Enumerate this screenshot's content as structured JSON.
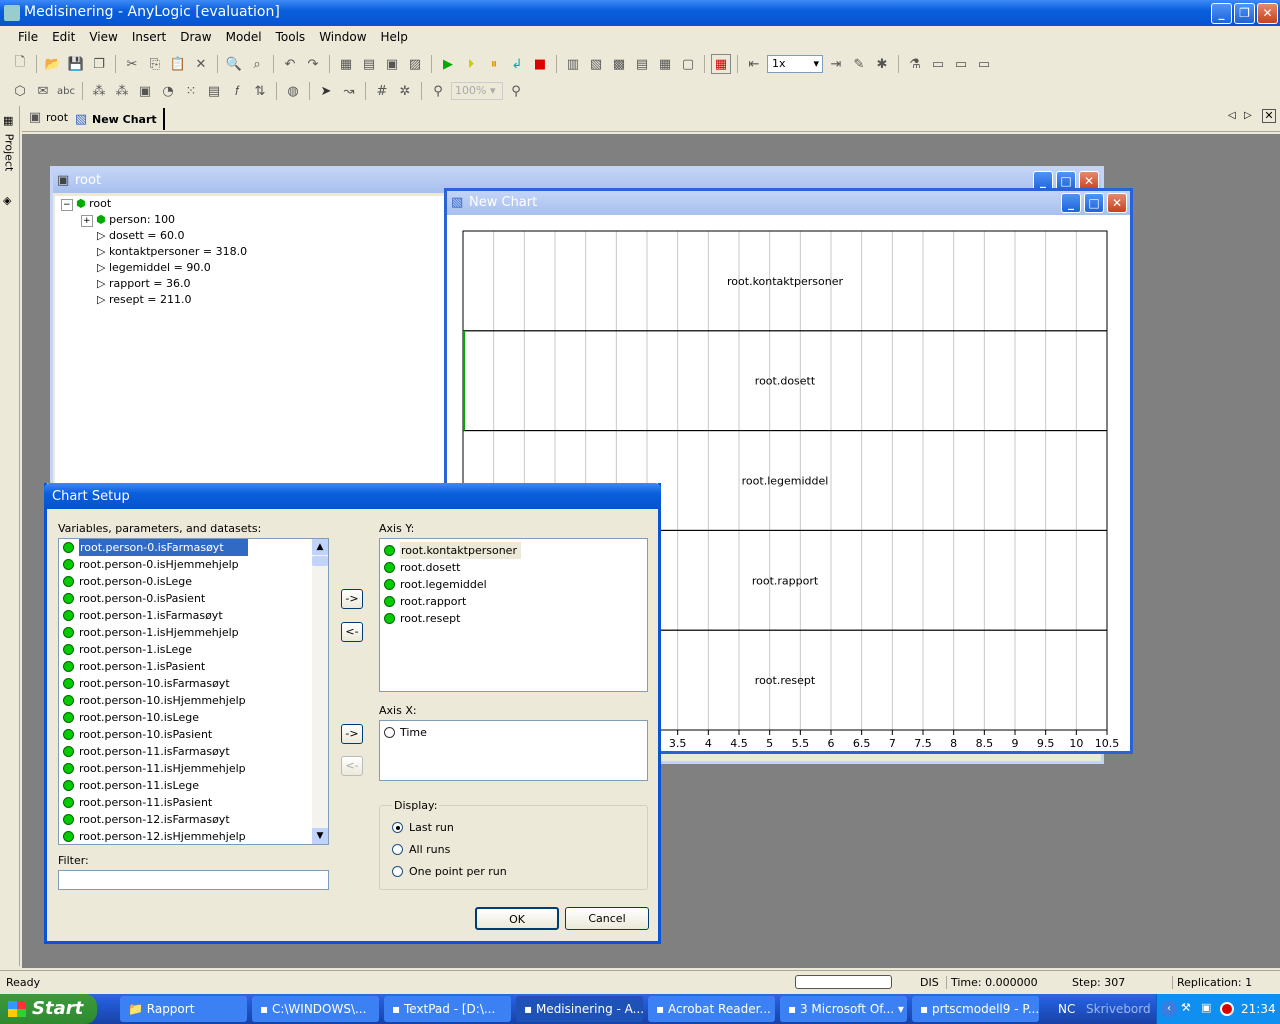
{
  "app": {
    "title": "Medisinering - AnyLogic [evaluation]"
  },
  "menu": [
    "File",
    "Edit",
    "View",
    "Insert",
    "Draw",
    "Model",
    "Tools",
    "Window",
    "Help"
  ],
  "toolbar": {
    "speed": "1x",
    "zoom": "100%"
  },
  "side_panel": {
    "label": "Project"
  },
  "tabs": [
    {
      "label": "root"
    },
    {
      "label": "New Chart"
    }
  ],
  "root_window": {
    "title": "root",
    "tree": {
      "root": "root",
      "items": [
        "person: 100",
        "dosett = 60.0",
        "kontaktpersoner = 318.0",
        "legemiddel = 90.0",
        "rapport = 36.0",
        "resept = 211.0"
      ]
    }
  },
  "chart_window": {
    "title": "New Chart",
    "panels": [
      "root.kontaktpersoner",
      "root.dosett",
      "root.legemiddel",
      "root.rapport",
      "root.resept"
    ],
    "x_ticks": [
      "3.5",
      "4",
      "4.5",
      "5",
      "5.5",
      "6",
      "6.5",
      "7",
      "7.5",
      "8",
      "8.5",
      "9",
      "9.5",
      "10",
      "10.5"
    ]
  },
  "chart_data": {
    "type": "line",
    "xlim": [
      0,
      10.5
    ],
    "grid": true,
    "series": [
      {
        "name": "root.kontaktpersoner",
        "values": []
      },
      {
        "name": "root.dosett",
        "values": []
      },
      {
        "name": "root.legemiddel",
        "values": []
      },
      {
        "name": "root.rapport",
        "values": []
      },
      {
        "name": "root.resept",
        "values": []
      }
    ]
  },
  "dialog": {
    "title": "Chart Setup",
    "vars_label": "Variables, parameters, and datasets:",
    "variables": [
      "root.person-0.isFarmasøyt",
      "root.person-0.isHjemmehjelp",
      "root.person-0.isLege",
      "root.person-0.isPasient",
      "root.person-1.isFarmasøyt",
      "root.person-1.isHjemmehjelp",
      "root.person-1.isLege",
      "root.person-1.isPasient",
      "root.person-10.isFarmasøyt",
      "root.person-10.isHjemmehjelp",
      "root.person-10.isLege",
      "root.person-10.isPasient",
      "root.person-11.isFarmasøyt",
      "root.person-11.isHjemmehjelp",
      "root.person-11.isLege",
      "root.person-11.isPasient",
      "root.person-12.isFarmasøyt",
      "root.person-12.isHjemmehjelp"
    ],
    "filter_label": "Filter:",
    "filter_value": "",
    "axis_y_label": "Axis Y:",
    "axis_y": [
      "root.kontaktpersoner",
      "root.dosett",
      "root.legemiddel",
      "root.rapport",
      "root.resept"
    ],
    "axis_x_label": "Axis X:",
    "axis_x": [
      "Time"
    ],
    "add": "->",
    "remove": "<-",
    "display_label": "Display:",
    "display_options": [
      "Last run",
      "All runs",
      "One point per run"
    ],
    "display_selected": "Last run",
    "ok": "OK",
    "cancel": "Cancel"
  },
  "status": {
    "ready": "Ready",
    "mode": "DIS",
    "time": "Time: 0.000000",
    "step": "Step: 307",
    "replication": "Replication: 1"
  },
  "taskbar": {
    "start": "Start",
    "items": [
      "Rapport",
      "C:\\WINDOWS\\...",
      "TextPad - [D:\\...",
      "Medisinering - A...",
      "Acrobat Reader...",
      "3 Microsoft Of...",
      "prtscmodell9 - P..."
    ],
    "tray": [
      "NC",
      "Skrivebord"
    ],
    "clock": "21:34"
  }
}
